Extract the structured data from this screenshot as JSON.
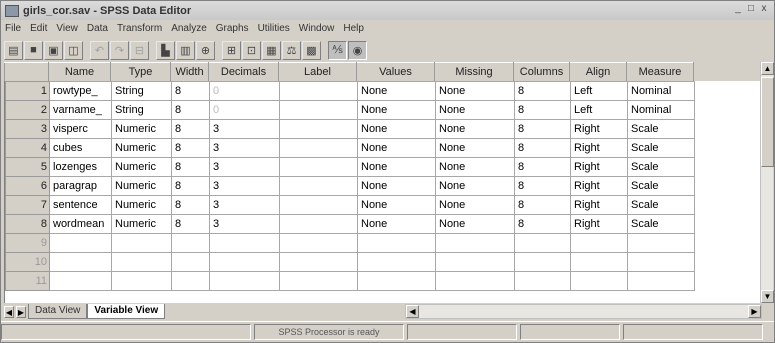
{
  "window": {
    "title": "girls_cor.sav - SPSS Data Editor",
    "buttons": [
      "_",
      "□",
      "x"
    ]
  },
  "menu": [
    "File",
    "Edit",
    "View",
    "Data",
    "Transform",
    "Analyze",
    "Graphs",
    "Utilities",
    "Window",
    "Help"
  ],
  "toolbar": {
    "buttons": [
      {
        "name": "open-icon",
        "glyph": "▤"
      },
      {
        "name": "save-icon",
        "glyph": "■"
      },
      {
        "name": "print-icon",
        "glyph": "▣"
      },
      {
        "name": "dialog-recall-icon",
        "glyph": "◫"
      },
      {
        "name": "undo-icon",
        "glyph": "↶",
        "grey": true
      },
      {
        "name": "redo-icon",
        "glyph": "↷",
        "grey": true
      },
      {
        "name": "goto-case-icon",
        "glyph": "⊟",
        "grey": true
      },
      {
        "name": "chart-icon",
        "glyph": "▙"
      },
      {
        "name": "variables-icon",
        "glyph": "▥"
      },
      {
        "name": "find-icon",
        "glyph": "⊕"
      },
      {
        "name": "insert-cases-icon",
        "glyph": "⊞"
      },
      {
        "name": "insert-variable-icon",
        "glyph": "⊡"
      },
      {
        "name": "split-file-icon",
        "glyph": "▦"
      },
      {
        "name": "weight-cases-icon",
        "glyph": "⚖"
      },
      {
        "name": "select-cases-icon",
        "glyph": "▩"
      },
      {
        "name": "value-labels-icon",
        "glyph": "⅍",
        "active": true
      },
      {
        "name": "use-sets-icon",
        "glyph": "◉",
        "active": true
      }
    ]
  },
  "grid": {
    "columns": [
      "Name",
      "Type",
      "Width",
      "Decimals",
      "Label",
      "Values",
      "Missing",
      "Columns",
      "Align",
      "Measure"
    ],
    "rows": [
      {
        "num": "1",
        "cells": [
          "rowtype_",
          "String",
          "8",
          "0",
          "",
          "None",
          "None",
          "8",
          "Left",
          "Nominal"
        ]
      },
      {
        "num": "2",
        "cells": [
          "varname_",
          "String",
          "8",
          "0",
          "",
          "None",
          "None",
          "8",
          "Left",
          "Nominal"
        ]
      },
      {
        "num": "3",
        "cells": [
          "visperc",
          "Numeric",
          "8",
          "3",
          "",
          "None",
          "None",
          "8",
          "Right",
          "Scale"
        ]
      },
      {
        "num": "4",
        "cells": [
          "cubes",
          "Numeric",
          "8",
          "3",
          "",
          "None",
          "None",
          "8",
          "Right",
          "Scale"
        ]
      },
      {
        "num": "5",
        "cells": [
          "lozenges",
          "Numeric",
          "8",
          "3",
          "",
          "None",
          "None",
          "8",
          "Right",
          "Scale"
        ]
      },
      {
        "num": "6",
        "cells": [
          "paragrap",
          "Numeric",
          "8",
          "3",
          "",
          "None",
          "None",
          "8",
          "Right",
          "Scale"
        ]
      },
      {
        "num": "7",
        "cells": [
          "sentence",
          "Numeric",
          "8",
          "3",
          "",
          "None",
          "None",
          "8",
          "Right",
          "Scale"
        ]
      },
      {
        "num": "8",
        "cells": [
          "wordmean",
          "Numeric",
          "8",
          "3",
          "",
          "None",
          "None",
          "8",
          "Right",
          "Scale"
        ]
      },
      {
        "num": "9",
        "cells": [
          "",
          "",
          "",
          "",
          "",
          "",
          "",
          "",
          "",
          ""
        ]
      },
      {
        "num": "10",
        "cells": [
          "",
          "",
          "",
          "",
          "",
          "",
          "",
          "",
          "",
          ""
        ]
      },
      {
        "num": "11",
        "cells": [
          "",
          "",
          "",
          "",
          "",
          "",
          "",
          "",
          "",
          ""
        ]
      }
    ]
  },
  "tabs": {
    "data_view": "Data View",
    "variable_view": "Variable View"
  },
  "status": "SPSS Processor is ready",
  "colors": {
    "selection_blue": "#2b40d0",
    "chrome": "#d4d0c8"
  }
}
